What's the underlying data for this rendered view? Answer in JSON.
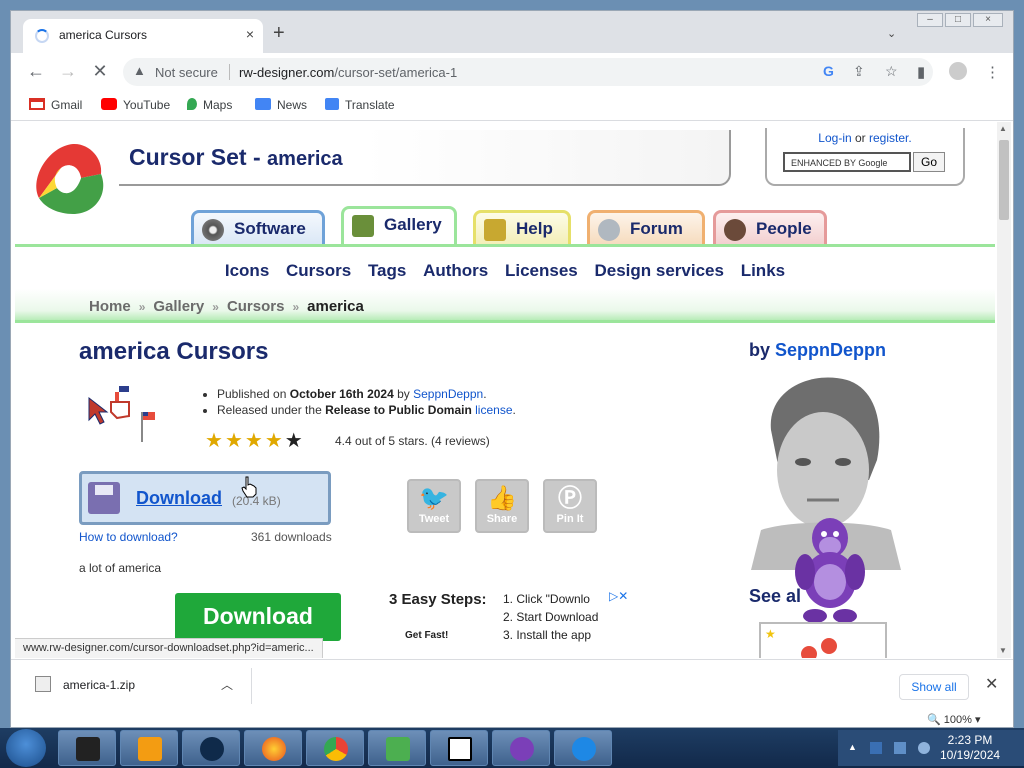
{
  "window": {
    "controls": [
      "–",
      "□",
      "×"
    ]
  },
  "browser": {
    "tab_title": "america Cursors",
    "new_tab": "+",
    "tab_close": "×",
    "address": {
      "security": "Not secure",
      "host": "rw-designer.com",
      "path": "/cursor-set/america-1"
    },
    "bookmarks": [
      {
        "label": "Gmail",
        "color": "#d93025"
      },
      {
        "label": "YouTube",
        "color": "#ff0000"
      },
      {
        "label": "Maps",
        "color": "#34a853"
      },
      {
        "label": "News",
        "color": "#4285f4"
      },
      {
        "label": "Translate",
        "color": "#4285f4"
      }
    ],
    "status_url": "www.rw-designer.com/cursor-downloadset.php?id=americ...",
    "zoom": "100%"
  },
  "site": {
    "title": "Cursor Set - ",
    "title_sub": "america",
    "login": "Log-in",
    "login_or": " or ",
    "register": "register.",
    "search_placeholder": "ENHANCED BY Google",
    "go": "Go",
    "nav_tabs": [
      {
        "label": "Software",
        "color": "#6fa2d8"
      },
      {
        "label": "Gallery",
        "color": "#9be59b"
      },
      {
        "label": "Help",
        "color": "#e6e069"
      },
      {
        "label": "Forum",
        "color": "#f0b070"
      },
      {
        "label": "People",
        "color": "#e59a9a"
      }
    ],
    "menu": [
      "Icons",
      "Cursors",
      "Tags",
      "Authors",
      "Licenses",
      "Design services",
      "Links"
    ],
    "breadcrumb": [
      "Home",
      "Gallery",
      "Cursors",
      "america"
    ],
    "breadcrumb_sep": "»"
  },
  "content": {
    "heading": "america Cursors",
    "by_label": "by ",
    "author": "SeppnDeppn",
    "published_prefix": "Published on ",
    "published_date": "October 16th 2024",
    "published_by": " by ",
    "released_prefix": "Released under the ",
    "license_name": "Release to Public Domain",
    "license_link": "license",
    "rating": {
      "value": 4.4,
      "max": 5,
      "text": "4.4 out of 5 stars. (4 reviews)"
    },
    "download_label": "Download",
    "download_size": "(20.4 kB)",
    "how_to": "How to download?",
    "downloads": "361 downloads",
    "description": "a lot of america",
    "share": [
      {
        "label": "Tweet",
        "glyph": "🐦"
      },
      {
        "label": "Share",
        "glyph": "👍"
      },
      {
        "label": "Pin It",
        "glyph": "Ⓟ"
      }
    ],
    "see_all": "See al",
    "ad": {
      "button": "Download",
      "title": "3 Easy Steps:",
      "steps": [
        "1. Click \"Downlo",
        "2. Start Download",
        "3.  Install the app"
      ],
      "brand": "Get Fast!"
    }
  },
  "download_shelf": {
    "file": "america-1.zip",
    "show_all": "Show all"
  },
  "taskbar": {
    "time": "2:23 PM",
    "date": "10/19/2024"
  }
}
